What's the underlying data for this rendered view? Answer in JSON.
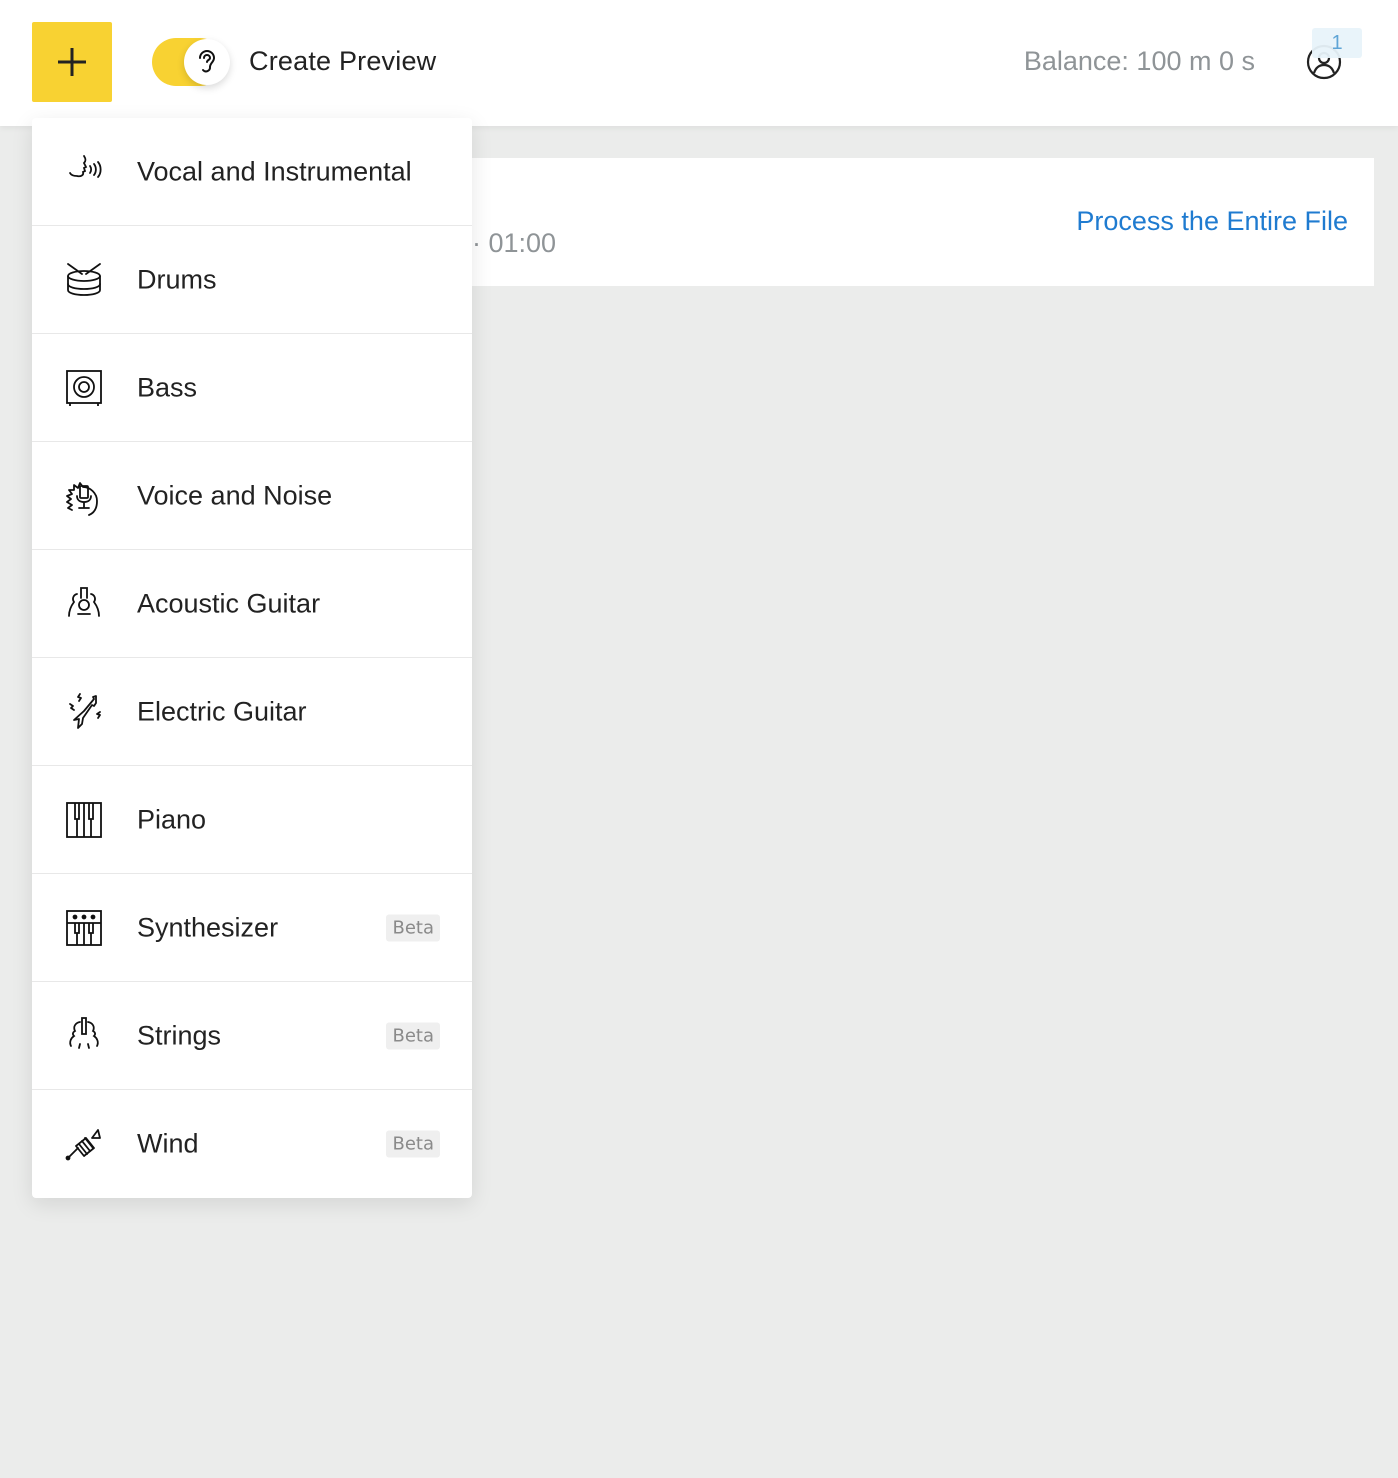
{
  "header": {
    "add_icon": "plus-icon",
    "preview_toggle": {
      "on": true,
      "icon": "ear-icon"
    },
    "preview_label": "Create Preview",
    "balance": "Balance: 100 m 0 s",
    "account_icon": "user-icon",
    "notification_count": "1"
  },
  "card": {
    "time_range": "· 01:00",
    "process_link": "Process the Entire File"
  },
  "menu": {
    "items": [
      {
        "label": "Vocal and Instrumental",
        "icon": "voice-icon",
        "badge": ""
      },
      {
        "label": "Drums",
        "icon": "drum-icon",
        "badge": ""
      },
      {
        "label": "Bass",
        "icon": "speaker-icon",
        "badge": ""
      },
      {
        "label": "Voice and Noise",
        "icon": "microphone-noise-icon",
        "badge": ""
      },
      {
        "label": "Acoustic Guitar",
        "icon": "acoustic-guitar-icon",
        "badge": ""
      },
      {
        "label": "Electric Guitar",
        "icon": "electric-guitar-icon",
        "badge": ""
      },
      {
        "label": "Piano",
        "icon": "piano-icon",
        "badge": ""
      },
      {
        "label": "Synthesizer",
        "icon": "synthesizer-icon",
        "badge": "Beta"
      },
      {
        "label": "Strings",
        "icon": "violin-icon",
        "badge": "Beta"
      },
      {
        "label": "Wind",
        "icon": "trumpet-icon",
        "badge": "Beta"
      }
    ]
  }
}
